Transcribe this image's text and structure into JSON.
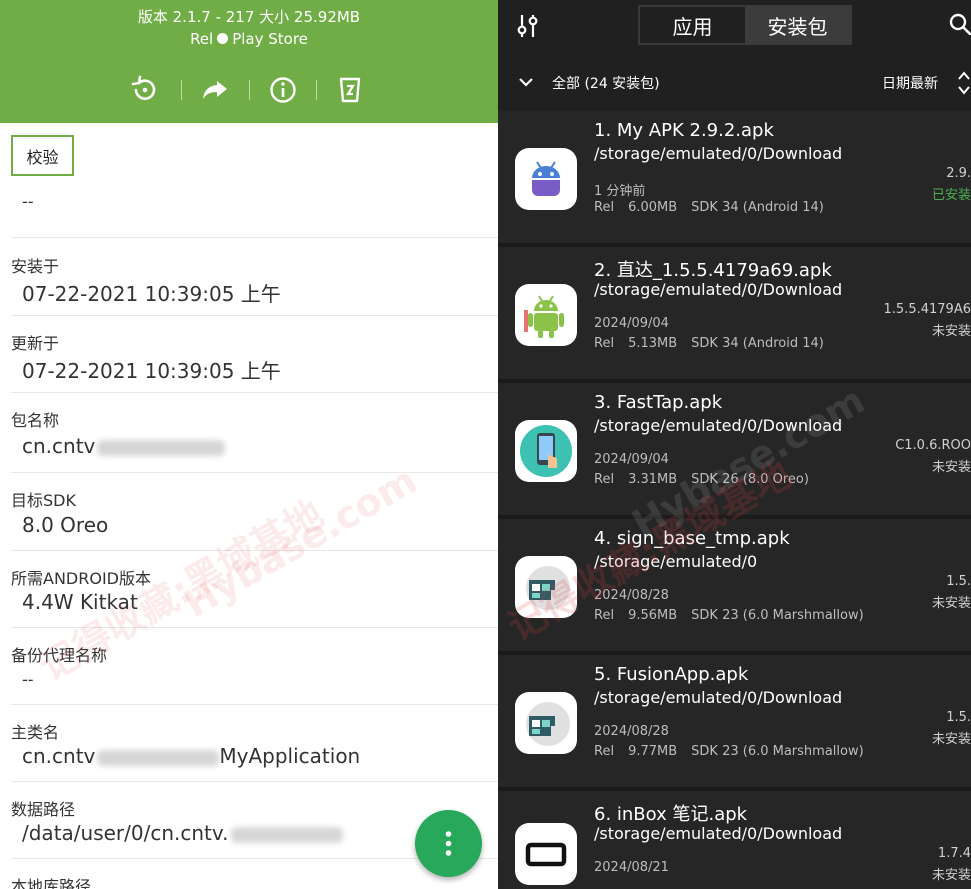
{
  "left": {
    "header": {
      "line1": "版本 2.1.7 - 217 大小 25.92MB",
      "badge": "Rel",
      "store": "Play Store",
      "actions": [
        "restore-icon",
        "share-icon",
        "info-icon",
        "uninstall-icon"
      ]
    },
    "verify_button": "校验",
    "verify_value": "--",
    "fields": [
      {
        "label": "安装于",
        "value": "07-22-2021 10:39:05 上午"
      },
      {
        "label": "更新于",
        "value": "07-22-2021 10:39:05 上午"
      },
      {
        "label": "包名称",
        "value": "cn.cntv",
        "blurred_suffix": true
      },
      {
        "label": "目标SDK",
        "value": "8.0 Oreo"
      },
      {
        "label": "所需ANDROID版本",
        "value": "4.4W Kitkat"
      },
      {
        "label": "备份代理名称",
        "value": "--"
      },
      {
        "label": "主类名",
        "value_prefix": "cn.cntv",
        "value_suffix": "MyApplication"
      },
      {
        "label": "数据路径",
        "value": "/data/user/0/cn.cntv."
      },
      {
        "label": "本地库路径",
        "value": ""
      }
    ],
    "fab_icon": "more-vertical-icon"
  },
  "right": {
    "tabs": [
      "应用",
      "安装包"
    ],
    "active_tab": 1,
    "filter": "全部 (24 安装包)",
    "sort": "日期最新",
    "items": [
      {
        "title": "1. My APK 2.9.2.apk",
        "path": "/storage/emulated/0/Download",
        "date": "1 分钟前",
        "rel": "Rel",
        "size": "6.00MB",
        "sdk": "SDK 34 (Android 14)",
        "version": "2.9.",
        "status": "已安装",
        "installed": true,
        "icon": "robot-icon"
      },
      {
        "title": "2. 直达_1.5.5.4179a69.apk",
        "path": "/storage/emulated/0/Download",
        "date": "2024/09/04",
        "rel": "Rel",
        "size": "5.13MB",
        "sdk": "SDK 34 (Android 14)",
        "version": "1.5.5.4179A6",
        "status": "未安装",
        "installed": false,
        "icon": "android-icon"
      },
      {
        "title": "3. FastTap.apk",
        "path": "/storage/emulated/0/Download",
        "date": "2024/09/04",
        "rel": "Rel",
        "size": "3.31MB",
        "sdk": "SDK 26 (8.0 Oreo)",
        "version": "C1.0.6.ROO",
        "status": "未安装",
        "installed": false,
        "icon": "tap-icon"
      },
      {
        "title": "4. sign_base_tmp.apk",
        "path": "/storage/emulated/0",
        "date": "2024/08/28",
        "rel": "Rel",
        "size": "9.56MB",
        "sdk": "SDK 23 (6.0 Marshmallow)",
        "version": "1.5.",
        "status": "未安装",
        "installed": false,
        "icon": "puzzle-icon"
      },
      {
        "title": "5. FusionApp.apk",
        "path": "/storage/emulated/0/Download",
        "date": "2024/08/28",
        "rel": "Rel",
        "size": "9.77MB",
        "sdk": "SDK 23 (6.0 Marshmallow)",
        "version": "1.5.",
        "status": "未安装",
        "installed": false,
        "icon": "puzzle-icon"
      },
      {
        "title": "6. inBox 笔记.apk",
        "path": "/storage/emulated/0/Download",
        "date": "2024/08/21",
        "rel": "",
        "size": "",
        "sdk": "",
        "version": "1.7.4",
        "status": "未安装",
        "installed": false,
        "icon": "box-icon"
      }
    ]
  },
  "watermark": {
    "line1": "记得收藏:黑域基地",
    "line2": "Hybase.com"
  }
}
